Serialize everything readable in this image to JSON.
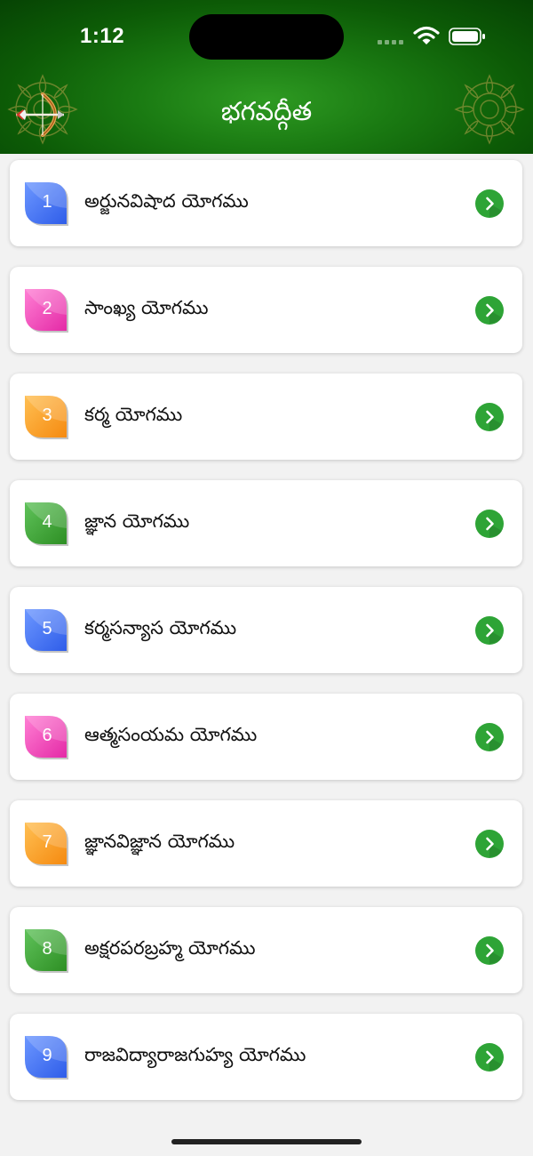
{
  "status_bar": {
    "time": "1:12"
  },
  "header": {
    "title": "భగవద్గీత"
  },
  "colors": {
    "header_green": "#1a7a12",
    "arrow_green": "#2ea436",
    "leaf_blue": "#3f6ff0",
    "leaf_pink": "#f23fb3",
    "leaf_orange": "#ff9a1f",
    "leaf_green": "#3ea22e"
  },
  "icons": {
    "header_left": "bow-and-arrow-icon",
    "decoration": "mandala-icon",
    "row_action": "chevron-right-icon"
  },
  "chapters": [
    {
      "number": "1",
      "title": "అర్జునవిషాద యోగము",
      "color": "blue"
    },
    {
      "number": "2",
      "title": "సాంఖ్య యోగము",
      "color": "pink"
    },
    {
      "number": "3",
      "title": "కర్మ యోగము",
      "color": "orange"
    },
    {
      "number": "4",
      "title": "జ్ఞాన యోగము",
      "color": "green"
    },
    {
      "number": "5",
      "title": "కర్మసన్యాస యోగము",
      "color": "blue"
    },
    {
      "number": "6",
      "title": "ఆత్మసంయమ యోగము",
      "color": "pink"
    },
    {
      "number": "7",
      "title": "జ్ఞానవిజ్ఞాన యోగము",
      "color": "orange"
    },
    {
      "number": "8",
      "title": "అక్షరపరబ్రహ్మ యోగము",
      "color": "green"
    },
    {
      "number": "9",
      "title": "రాజవిద్యారాజగుహ్య యోగము",
      "color": "blue"
    }
  ]
}
